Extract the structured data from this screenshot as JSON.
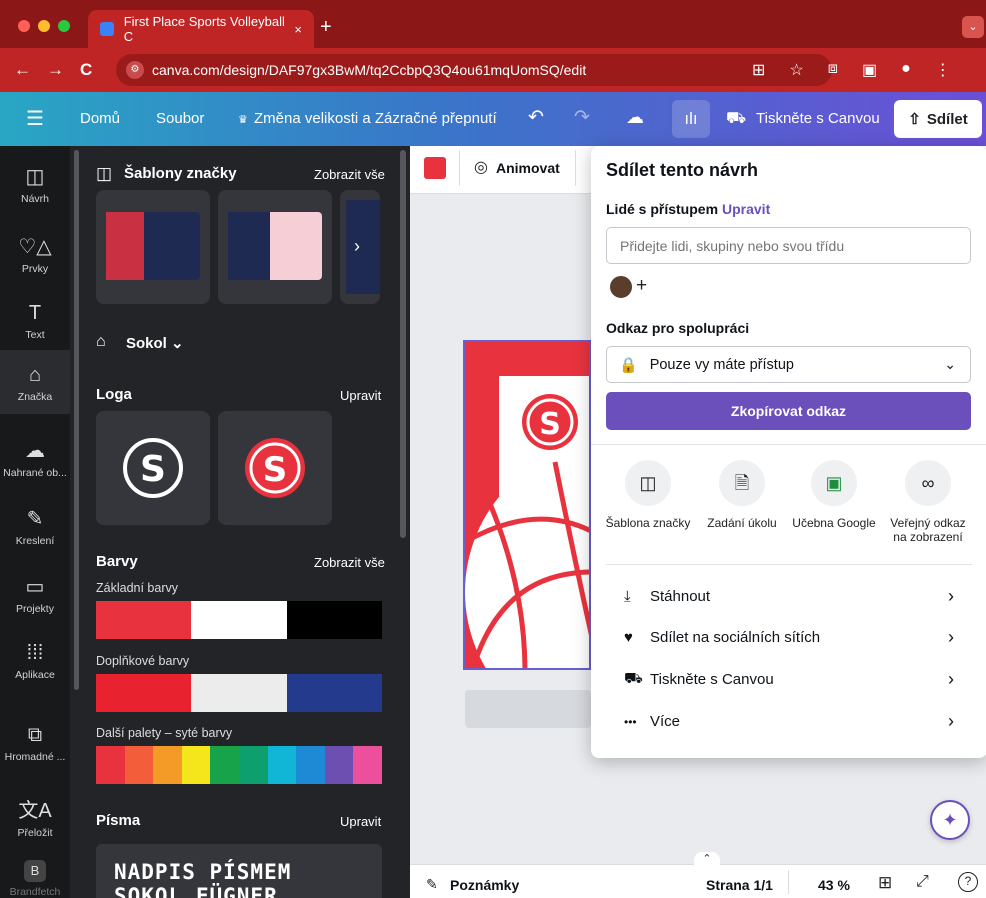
{
  "browser": {
    "tab_title": "First Place Sports Volleyball C",
    "tab_close": "×",
    "new_tab": "+",
    "url": "canva.com/design/DAF97gx3BwM/tq2CcbpQ3Q4ou61mqUomSQ/edit",
    "nav_back": "←",
    "nav_forward": "→",
    "reload": "C"
  },
  "topbar": {
    "menu_icon": "☰",
    "home": "Domů",
    "file": "Soubor",
    "resize": "Změna velikosti a Zázračné přepnutí",
    "print": "Tiskněte s Canvou",
    "share": "Sdílet"
  },
  "rail": {
    "items": [
      {
        "label": "Návrh",
        "icon": "◫"
      },
      {
        "label": "Prvky",
        "icon": "♡△"
      },
      {
        "label": "Text",
        "icon": "T"
      },
      {
        "label": "Značka",
        "icon": "⌂"
      },
      {
        "label": "Nahrané ob...",
        "icon": "☁"
      },
      {
        "label": "Kreslení",
        "icon": "✎"
      },
      {
        "label": "Projekty",
        "icon": "▭"
      },
      {
        "label": "Aplikace",
        "icon": "⁞⁞⁞"
      },
      {
        "label": "Hromadné ...",
        "icon": "⧉"
      },
      {
        "label": "Přeložit",
        "icon": "文A"
      },
      {
        "label": "Brandfetch",
        "icon": "B"
      }
    ]
  },
  "panel": {
    "templates_title": "Šablony značky",
    "templates_all": "Zobrazit vše",
    "brand_kit": "Sokol",
    "logos_title": "Loga",
    "logos_edit": "Upravit",
    "colors_title": "Barvy",
    "colors_all": "Zobrazit vše",
    "palette1_label": "Základní barvy",
    "palette1": [
      "#e8333f",
      "#ffffff",
      "#000000"
    ],
    "palette2_label": "Doplňkové barvy",
    "palette2": [
      "#e8222e",
      "#ececec",
      "#243a8c"
    ],
    "palette3_label": "Další palety – syté barvy",
    "palette3": [
      "#e8333f",
      "#f35d3a",
      "#f39a27",
      "#f5e51b",
      "#16a34a",
      "#0e9f6e",
      "#11b5d6",
      "#1e8ad6",
      "#6c4fb0",
      "#ec4f9c"
    ],
    "fonts_title": "Písma",
    "fonts_edit": "Upravit",
    "font_preview": "NADPIS PÍSMEM SOKOL FÜGNER"
  },
  "editor": {
    "animate": "Animovat",
    "notes": "Poznámky",
    "page": "Strana 1/1",
    "zoom": "43 %"
  },
  "share_popup": {
    "title": "Sdílet tento návrh",
    "people_label": "Lidé s přístupem",
    "people_edit": "Upravit",
    "people_placeholder": "Přidejte lidi, skupiny nebo svou třídu",
    "link_label": "Odkaz pro spolupráci",
    "access_value": "Pouze vy máte přístup",
    "copy_button": "Zkopírovat odkaz",
    "options": [
      {
        "label": "Šablona značky",
        "icon": "◫"
      },
      {
        "label": "Zadání úkolu",
        "icon": "🗎"
      },
      {
        "label": "Učebna Google",
        "icon": "▣"
      },
      {
        "label": "Veřejný odkaz na zobrazení",
        "icon": "∞"
      }
    ],
    "menu": [
      {
        "label": "Stáhnout",
        "icon": "⤓"
      },
      {
        "label": "Sdílet na sociálních sítích",
        "icon": "♥"
      },
      {
        "label": "Tiskněte s Canvou",
        "icon": "⛟"
      },
      {
        "label": "Více",
        "icon": "•••"
      }
    ],
    "colors": {
      "accent": "#6b4fbb"
    }
  }
}
